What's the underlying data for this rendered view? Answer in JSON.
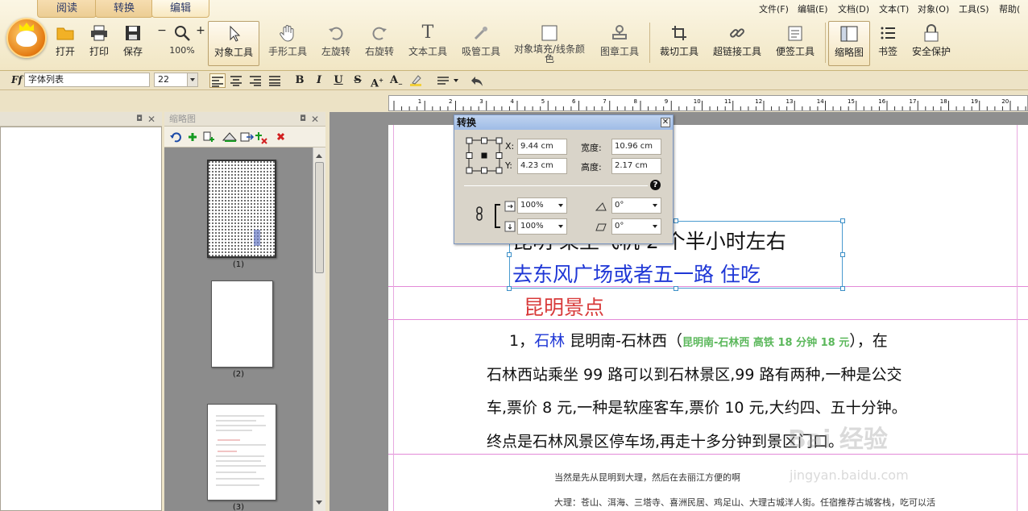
{
  "tabs": [
    "阅读",
    "转换",
    "编辑"
  ],
  "menu": [
    "文件(F)",
    "编辑(E)",
    "文档(D)",
    "文本(T)",
    "对象(O)",
    "工具(S)",
    "帮助("
  ],
  "toolbar": {
    "open": "打开",
    "print": "打印",
    "save": "保存",
    "zoom_minus": "−",
    "zoom_plus": "+",
    "zoom": "100%",
    "object_tool": "对象工具",
    "hand_tool": "手形工具",
    "rotate_left": "左旋转",
    "rotate_right": "右旋转",
    "text_tool": "文本工具",
    "eyedropper": "吸管工具",
    "fill_color": "对象填充/线条颜色",
    "stamp_tool": "图章工具",
    "crop_tool": "裁切工具",
    "link_tool": "超链接工具",
    "note_tool": "便签工具",
    "thumbnails": "缩略图",
    "bookmarks": "书签",
    "security": "安全保护"
  },
  "format": {
    "font_placeholder": "字体列表",
    "font_size": "22",
    "bold": "B",
    "italic": "I",
    "underline": "U",
    "strike": "S",
    "superscript": "A",
    "subscript": "A"
  },
  "ruler": {
    "labels": [
      "1",
      "2",
      "3",
      "4",
      "5",
      "6",
      "7",
      "8",
      "9",
      "10",
      "11",
      "12",
      "13",
      "14",
      "15",
      "16",
      "17",
      "18",
      "19",
      "20"
    ]
  },
  "panels": {
    "left_title": "",
    "thumb_title": "缩略图"
  },
  "thumbs": [
    {
      "label": "(1)"
    },
    {
      "label": "(2)"
    },
    {
      "label": "(3)"
    }
  ],
  "dialog": {
    "title": "转换",
    "x_label": "X:",
    "x_value": "9.44 cm",
    "y_label": "Y:",
    "y_value": "4.23 cm",
    "w_label": "宽度:",
    "w_value": "10.96 cm",
    "h_label": "高度:",
    "h_value": "2.17 cm",
    "help": "?",
    "scale_x": "100%",
    "scale_y": "100%",
    "rotate": "0°",
    "skew": "0°"
  },
  "doc": {
    "line1": "昆明  乘坐飞机 2 个半小时左右",
    "line2": "去东风广场或者五一路  住吃",
    "heading": "昆明景点",
    "p1_num": "1，",
    "p1_link": "石林",
    "p1_text": "   昆明南-石林西（",
    "p1_green": "昆明南-石林西  高铁  18 分钟 18 元",
    "p1_end": "），在",
    "p2": "石林西站乘坐 99 路可以到石林景区,99 路有两种,一种是公交",
    "p3": "车,票价 8 元,一种是软座客车,票价  10 元,大约四、五十分钟。",
    "p4": "终点是石林风景区停车场,再走十多分钟到景区门口。",
    "p5": "当然是先从昆明到大理，然后在去丽江方便的啊",
    "p6": "大理：苍山、洱海、三塔寺、喜洲民居、鸡足山、大理古城洋人街。任宿推荐古城客栈，吃可以活"
  },
  "watermark": {
    "main": "Bai 经验",
    "sub": "jingyan.baidu.com"
  },
  "colors": {
    "accent_blue": "#1f37d6",
    "heading_red": "#d83a3a",
    "green": "#5cb85c",
    "guide_pink": "#e38ad8"
  }
}
